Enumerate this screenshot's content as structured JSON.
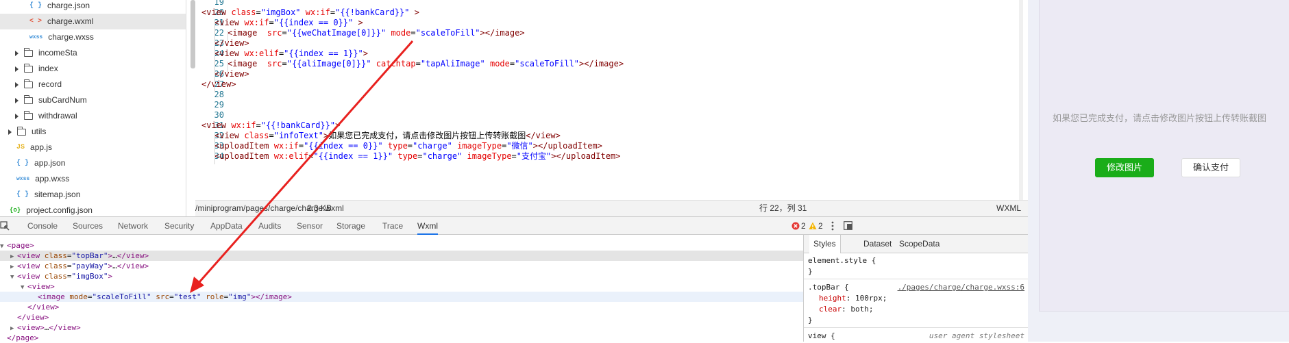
{
  "tree": [
    {
      "name": "charge.json",
      "icon": "json-file-icon",
      "glyph": "{ }"
    },
    {
      "name": "charge.wxml",
      "icon": "wxml-file-icon",
      "glyph": "< >"
    },
    {
      "name": "charge.wxss",
      "icon": "wxss-file-icon",
      "glyph": "wxss"
    },
    {
      "name": "incomeSta",
      "icon": "folder-icon"
    },
    {
      "name": "index",
      "icon": "folder-icon"
    },
    {
      "name": "record",
      "icon": "folder-icon"
    },
    {
      "name": "subCardNum",
      "icon": "folder-icon"
    },
    {
      "name": "withdrawal",
      "icon": "folder-icon"
    },
    {
      "name": "utils",
      "icon": "folder-icon"
    },
    {
      "name": "app.js",
      "icon": "js-file-icon",
      "glyph": "JS"
    },
    {
      "name": "app.json",
      "icon": "json-file-icon",
      "glyph": "{ }"
    },
    {
      "name": "app.wxss",
      "icon": "wxss-file-icon",
      "glyph": "wxss"
    },
    {
      "name": "sitemap.json",
      "icon": "json-file-icon",
      "glyph": "{ }"
    },
    {
      "name": "project.config.json",
      "icon": "config-file-icon",
      "glyph": "{o}"
    }
  ],
  "editor": {
    "line_numbers": [
      "19",
      "20",
      "21",
      "22",
      "23",
      "24",
      "25",
      "26",
      "27",
      "28",
      "29",
      "30",
      "31",
      "32",
      "33",
      "34"
    ],
    "lines": [
      [],
      [
        [
          "t",
          "<view "
        ],
        [
          "a",
          "class"
        ],
        [
          "x",
          "="
        ],
        [
          "v",
          "\"imgBox\""
        ],
        [
          "x",
          " "
        ],
        [
          "a",
          "wx:if"
        ],
        [
          "x",
          "="
        ],
        [
          "v",
          "\"{{!bankCard}}\""
        ],
        [
          "x",
          " "
        ],
        [
          "t",
          ">"
        ]
      ],
      [
        [
          "t",
          "<view "
        ],
        [
          "a",
          "wx:if"
        ],
        [
          "x",
          "="
        ],
        [
          "v",
          "\"{{index == 0}}\""
        ],
        [
          "x",
          " "
        ],
        [
          "t",
          ">"
        ]
      ],
      [
        [
          "t",
          "<image  "
        ],
        [
          "a",
          "src"
        ],
        [
          "x",
          "="
        ],
        [
          "v",
          "\"{{weChatImage[0]}}\""
        ],
        [
          "x",
          " "
        ],
        [
          "a",
          "mode"
        ],
        [
          "x",
          "="
        ],
        [
          "v",
          "\"scaleToFill\""
        ],
        [
          "t",
          "></image>"
        ]
      ],
      [
        [
          "t",
          "</view>"
        ]
      ],
      [
        [
          "t",
          "<view "
        ],
        [
          "a",
          "wx:elif"
        ],
        [
          "x",
          "="
        ],
        [
          "v",
          "\"{{index == 1}}\""
        ],
        [
          "t",
          ">"
        ]
      ],
      [
        [
          "t",
          "<image  "
        ],
        [
          "a",
          "src"
        ],
        [
          "x",
          "="
        ],
        [
          "v",
          "\"{{aliImage[0]}}\""
        ],
        [
          "x",
          " "
        ],
        [
          "a",
          "catchtap"
        ],
        [
          "x",
          "="
        ],
        [
          "v",
          "\"tapAliImage\""
        ],
        [
          "x",
          " "
        ],
        [
          "a",
          "mode"
        ],
        [
          "x",
          "="
        ],
        [
          "v",
          "\"scaleToFill\""
        ],
        [
          "t",
          "></image>"
        ]
      ],
      [
        [
          "t",
          "</view>"
        ]
      ],
      [
        [
          "t",
          "</view>"
        ]
      ],
      [],
      [],
      [],
      [
        [
          "t",
          "<view "
        ],
        [
          "a",
          "wx:if"
        ],
        [
          "x",
          "="
        ],
        [
          "v",
          "\"{{!bankCard}}\""
        ],
        [
          "t",
          ">"
        ]
      ],
      [
        [
          "t",
          "<view "
        ],
        [
          "a",
          "class"
        ],
        [
          "x",
          "="
        ],
        [
          "v",
          "\"infoText\""
        ],
        [
          "t",
          ">"
        ],
        [
          "x",
          "如果您已完成支付，请点击修改图片按钮上传转账截图"
        ],
        [
          "t",
          "</view>"
        ]
      ],
      [
        [
          "t",
          "<uploadItem "
        ],
        [
          "a",
          "wx:if"
        ],
        [
          "x",
          "="
        ],
        [
          "v",
          "\"{{index == 0}}\""
        ],
        [
          "x",
          " "
        ],
        [
          "a",
          "type"
        ],
        [
          "x",
          "="
        ],
        [
          "v",
          "\"charge\""
        ],
        [
          "x",
          " "
        ],
        [
          "a",
          "imageType"
        ],
        [
          "x",
          "="
        ],
        [
          "v",
          "\"微信\""
        ],
        [
          "t",
          "></uploadItem>"
        ]
      ],
      [
        [
          "t",
          "<uploadItem "
        ],
        [
          "a",
          "wx:elif"
        ],
        [
          "x",
          "="
        ],
        [
          "v",
          "\"{{index == 1}}\""
        ],
        [
          "x",
          " "
        ],
        [
          "a",
          "type"
        ],
        [
          "x",
          "="
        ],
        [
          "v",
          "\"charge\""
        ],
        [
          "x",
          " "
        ],
        [
          "a",
          "imageType"
        ],
        [
          "x",
          "="
        ],
        [
          "v",
          "\"支付宝\""
        ],
        [
          "t",
          "></uploadItem>"
        ]
      ]
    ]
  },
  "status": {
    "path": "/miniprogram/pages/charge/charge.wxml",
    "size": "2.3 KB",
    "cursor": "行 22，列 31",
    "lang": "WXML"
  },
  "devtools": {
    "tabs": [
      "Console",
      "Sources",
      "Network",
      "Security",
      "AppData",
      "Audits",
      "Sensor",
      "Storage",
      "Trace",
      "Wxml"
    ],
    "active_tab": "Wxml",
    "errors": "2",
    "warnings": "2"
  },
  "dom": [
    [
      [
        "t",
        "<page>"
      ]
    ],
    [
      [
        "t",
        "<view "
      ],
      [
        "a",
        "class"
      ],
      [
        "x",
        "="
      ],
      [
        "v",
        "\"topBar\""
      ],
      [
        "t",
        ">"
      ],
      [
        "x",
        "…"
      ],
      [
        "t",
        "</view>"
      ]
    ],
    [
      [
        "t",
        "<view "
      ],
      [
        "a",
        "class"
      ],
      [
        "x",
        "="
      ],
      [
        "v",
        "\"payWay\""
      ],
      [
        "t",
        ">"
      ],
      [
        "x",
        "…"
      ],
      [
        "t",
        "</view>"
      ]
    ],
    [
      [
        "t",
        "<view "
      ],
      [
        "a",
        "class"
      ],
      [
        "x",
        "="
      ],
      [
        "v",
        "\"imgBox\""
      ],
      [
        "t",
        ">"
      ]
    ],
    [
      [
        "t",
        "<view>"
      ]
    ],
    [
      [
        "t",
        "<image "
      ],
      [
        "a",
        "mode"
      ],
      [
        "x",
        "="
      ],
      [
        "v",
        "\"scaleToFill\""
      ],
      [
        "x",
        " "
      ],
      [
        "a",
        "src"
      ],
      [
        "x",
        "="
      ],
      [
        "v",
        "\"test\""
      ],
      [
        "x",
        " "
      ],
      [
        "a",
        "role"
      ],
      [
        "x",
        "="
      ],
      [
        "v",
        "\"img\""
      ],
      [
        "t",
        "></image>"
      ]
    ],
    [
      [
        "t",
        "</view>"
      ]
    ],
    [
      [
        "t",
        "</view>"
      ]
    ],
    [
      [
        "t",
        "<view>"
      ],
      [
        "x",
        "…"
      ],
      [
        "t",
        "</view>"
      ]
    ],
    [
      [
        "t",
        "</page>"
      ]
    ]
  ],
  "styles": {
    "tabs": [
      "Styles",
      "Dataset",
      "ScopeData"
    ],
    "rules": [
      {
        "selector": "element.style {",
        "props": [],
        "close": "}"
      },
      {
        "selector": ".topBar {",
        "source": "./pages/charge/charge.wxss:6",
        "props": [
          [
            "height",
            "100rpx;"
          ],
          [
            "clear",
            "both;"
          ]
        ],
        "close": "}"
      },
      {
        "selector": "view {",
        "source": "user agent stylesheet"
      }
    ]
  },
  "simulator": {
    "info_text": "如果您已完成支付，请点击修改图片按钮上传转账截图",
    "edit_button": "修改图片",
    "confirm_button": "确认支付"
  },
  "colors": {
    "accent_green": "#1aad19",
    "annotation_arrow": "#e8211f",
    "error": "#e53935",
    "warning": "#f4b400"
  }
}
